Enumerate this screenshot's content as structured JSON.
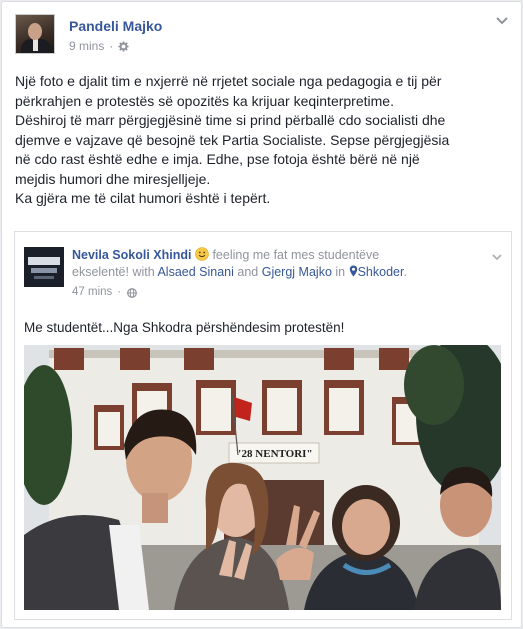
{
  "post": {
    "author": "Pandeli Majko",
    "time": "9 mins",
    "dot": "·",
    "text_lines": [
      "Një foto e djalit tim e nxjerrë në rrjetet sociale nga pedagogia e tij për",
      "përkrahjen e protestës së opozitës ka krijuar keqinterpretime.",
      "Dëshiroj të marr përgjegjësinë time si prind përballë cdo socialisti dhe",
      "djemve e vajzave që besojnë tek Partia Socialiste. Sepse përgjegjësia",
      "në cdo rast është edhe e imja. Edhe, pse fotoja është bërë në një",
      "mejdis humori dhe miresjelljeje.",
      "Ka gjëra me të cilat humori është i tepërt."
    ]
  },
  "shared": {
    "author": "Nevila Sokoli Xhindi",
    "feeling_text": " feeling me fat mes studentëve eksele‌ntë! with ",
    "feeling_a": " feeling me fat mes studentëve",
    "feeling_b": "ekselentë! with ",
    "with_1": "Alsaed Sinani",
    "and": " and ",
    "with_2": "Gjergj Majko",
    "in": " in ",
    "place": "Shkoder",
    "period": ".",
    "time": "47 mins",
    "dot": "·",
    "caption": "Me studentët...Nga Shkodra përshëndesim protestën!",
    "photo_sign": "\"28 NENTORI\""
  },
  "icons": {
    "post_menu": "chevron-down-icon",
    "privacy": "gear-icon",
    "feeling": "smiley-icon",
    "location": "map-pin-icon",
    "shared_privacy": "globe-icon"
  },
  "colors": {
    "link": "#365899",
    "muted": "#90949c",
    "text": "#1d2129",
    "border": "#dddfe2"
  }
}
